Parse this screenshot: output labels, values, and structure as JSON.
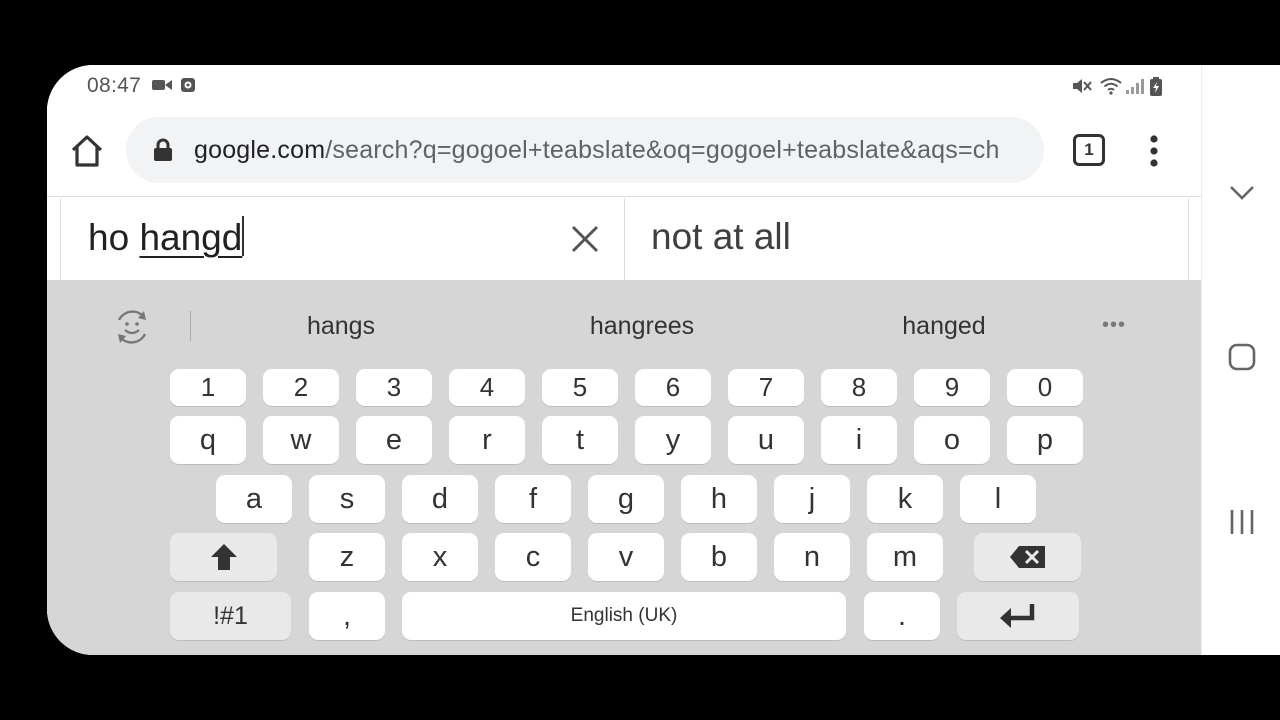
{
  "status_bar": {
    "time": "08:47",
    "left_icons": [
      "video-camera-icon",
      "screen-record-icon"
    ],
    "right_icons": [
      "mute-icon",
      "wifi-icon",
      "signal-icon",
      "battery-icon"
    ]
  },
  "toolbar": {
    "url_host": "google.com",
    "url_path": "/search?q=gogoel+teabslate&oq=gogoel+teabslate&aqs=ch",
    "tab_count": "1",
    "icons": [
      "home-icon",
      "lock-icon",
      "tab-switcher-icon",
      "more-vertical-icon"
    ]
  },
  "content": {
    "input_prefix": "ho ",
    "input_composing": "hangd",
    "answer_text": "not at all"
  },
  "keyboard": {
    "suggestions": [
      "hangs",
      "hangrees",
      "hanged"
    ],
    "more_label": "•••",
    "number_row": [
      "1",
      "2",
      "3",
      "4",
      "5",
      "6",
      "7",
      "8",
      "9",
      "0"
    ],
    "row1": [
      "q",
      "w",
      "e",
      "r",
      "t",
      "y",
      "u",
      "i",
      "o",
      "p"
    ],
    "row2": [
      "a",
      "s",
      "d",
      "f",
      "g",
      "h",
      "j",
      "k",
      "l"
    ],
    "row3": [
      "z",
      "x",
      "c",
      "v",
      "b",
      "n",
      "m"
    ],
    "symbols_label": "!#1",
    "comma_label": ",",
    "space_label": "English (UK)",
    "period_label": "."
  },
  "navbar": {
    "icons": [
      "collapse-chevron-icon",
      "home-square-icon",
      "recents-icon"
    ]
  }
}
